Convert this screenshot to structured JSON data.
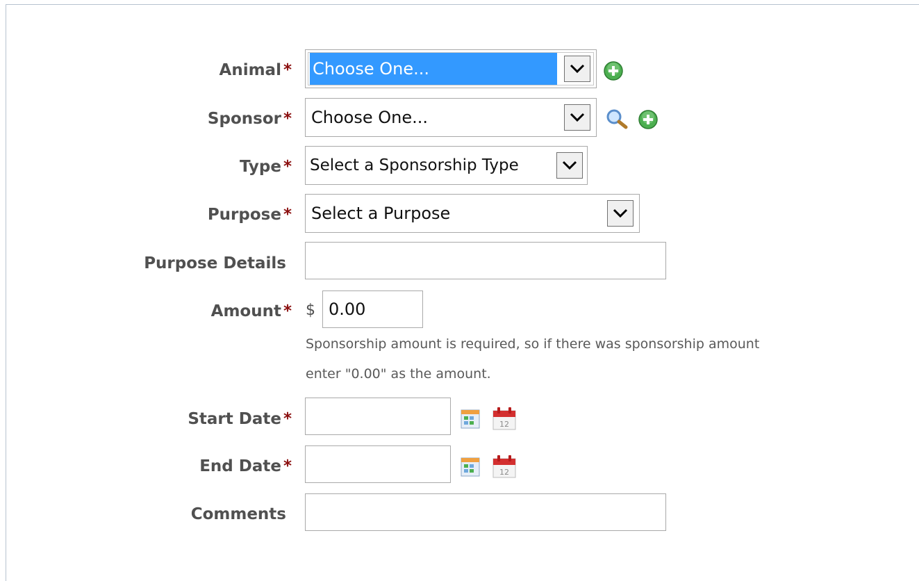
{
  "form": {
    "animal": {
      "label": "Animal",
      "required_mark": "*",
      "value": "Choose One..."
    },
    "sponsor": {
      "label": "Sponsor",
      "required_mark": "*",
      "value": "Choose One..."
    },
    "type": {
      "label": "Type",
      "required_mark": "*",
      "value": "Select a Sponsorship Type"
    },
    "purpose": {
      "label": "Purpose",
      "required_mark": "*",
      "value": "Select a Purpose"
    },
    "purpose_details": {
      "label": "Purpose Details",
      "value": ""
    },
    "amount": {
      "label": "Amount",
      "required_mark": "*",
      "currency": "$",
      "value": "0.00",
      "hint_line1": "Sponsorship amount is required, so if there was sponsorship amount",
      "hint_line2": "enter \"0.00\" as the amount."
    },
    "start_date": {
      "label": "Start Date",
      "required_mark": "*",
      "value": ""
    },
    "end_date": {
      "label": "End Date",
      "required_mark": "*",
      "value": ""
    },
    "comments": {
      "label": "Comments",
      "value": ""
    }
  },
  "icons": {
    "add": "add-icon",
    "search": "search-icon",
    "calendar_picker": "calendar-picker-icon",
    "calendar_today": "calendar-today-icon"
  },
  "colors": {
    "required": "#8b0f0f",
    "label": "#505050",
    "selection": "#3399ff",
    "add_green": "#4caf50"
  }
}
